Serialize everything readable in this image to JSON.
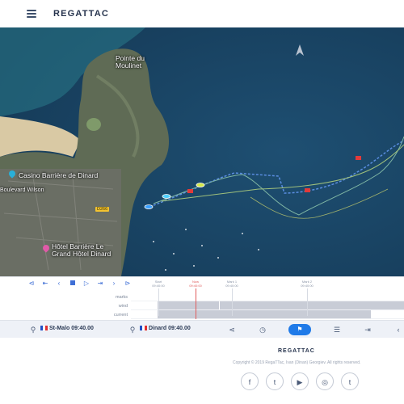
{
  "header": {
    "logo": "REGATTAC",
    "menu_icon": "hamburger-icon"
  },
  "map": {
    "labels": {
      "pointe": "Pointe du\nMoulinet",
      "casino": "Casino Barrière de Dinard",
      "boulevard": "Boulevard Wilson",
      "road": "D266",
      "hotel": "Hôtel Barrière Le\nGrand Hôtel Dinard"
    },
    "compass_icon": "north-arrow-icon"
  },
  "timeline": {
    "controls": [
      "skip-start-icon",
      "step-back-icon",
      "prev-icon",
      "stop-icon",
      "play-icon",
      "next-icon",
      "step-forward-icon",
      "skip-end-icon"
    ],
    "marks": [
      {
        "name": "Start",
        "time": "09:40:00"
      },
      {
        "name": "Now",
        "time": "09:40:00"
      },
      {
        "name": "Mark 1",
        "time": "09:40:00"
      },
      {
        "name": "Mark 2",
        "time": "09:40:00"
      }
    ],
    "tracks": [
      "marks",
      "wind",
      "current"
    ]
  },
  "toolbar": {
    "from": "St-Malo 09:40.00",
    "to": "Dinard 09:40.00",
    "icons": [
      "share-icon",
      "timer-icon",
      "race-flag-icon",
      "list-icon",
      "exit-icon",
      "chevron-icon"
    ]
  },
  "footer": {
    "logo": "REGATTAC",
    "copyright": "Copyright © 2019 RegaTTac, Ivan (Dinan) Georgiev. All rights reserved.",
    "social": [
      {
        "name": "facebook-icon",
        "glyph": "f"
      },
      {
        "name": "twitter-icon",
        "glyph": "t"
      },
      {
        "name": "youtube-icon",
        "glyph": "▶"
      },
      {
        "name": "instagram-icon",
        "glyph": "◎"
      },
      {
        "name": "tumblr-icon",
        "glyph": "t"
      }
    ]
  },
  "colors": {
    "accent": "#1f7ae8",
    "sea": "#1d4b6e",
    "playhead": "#e05c5c",
    "track_route": "#6d8fd8"
  }
}
